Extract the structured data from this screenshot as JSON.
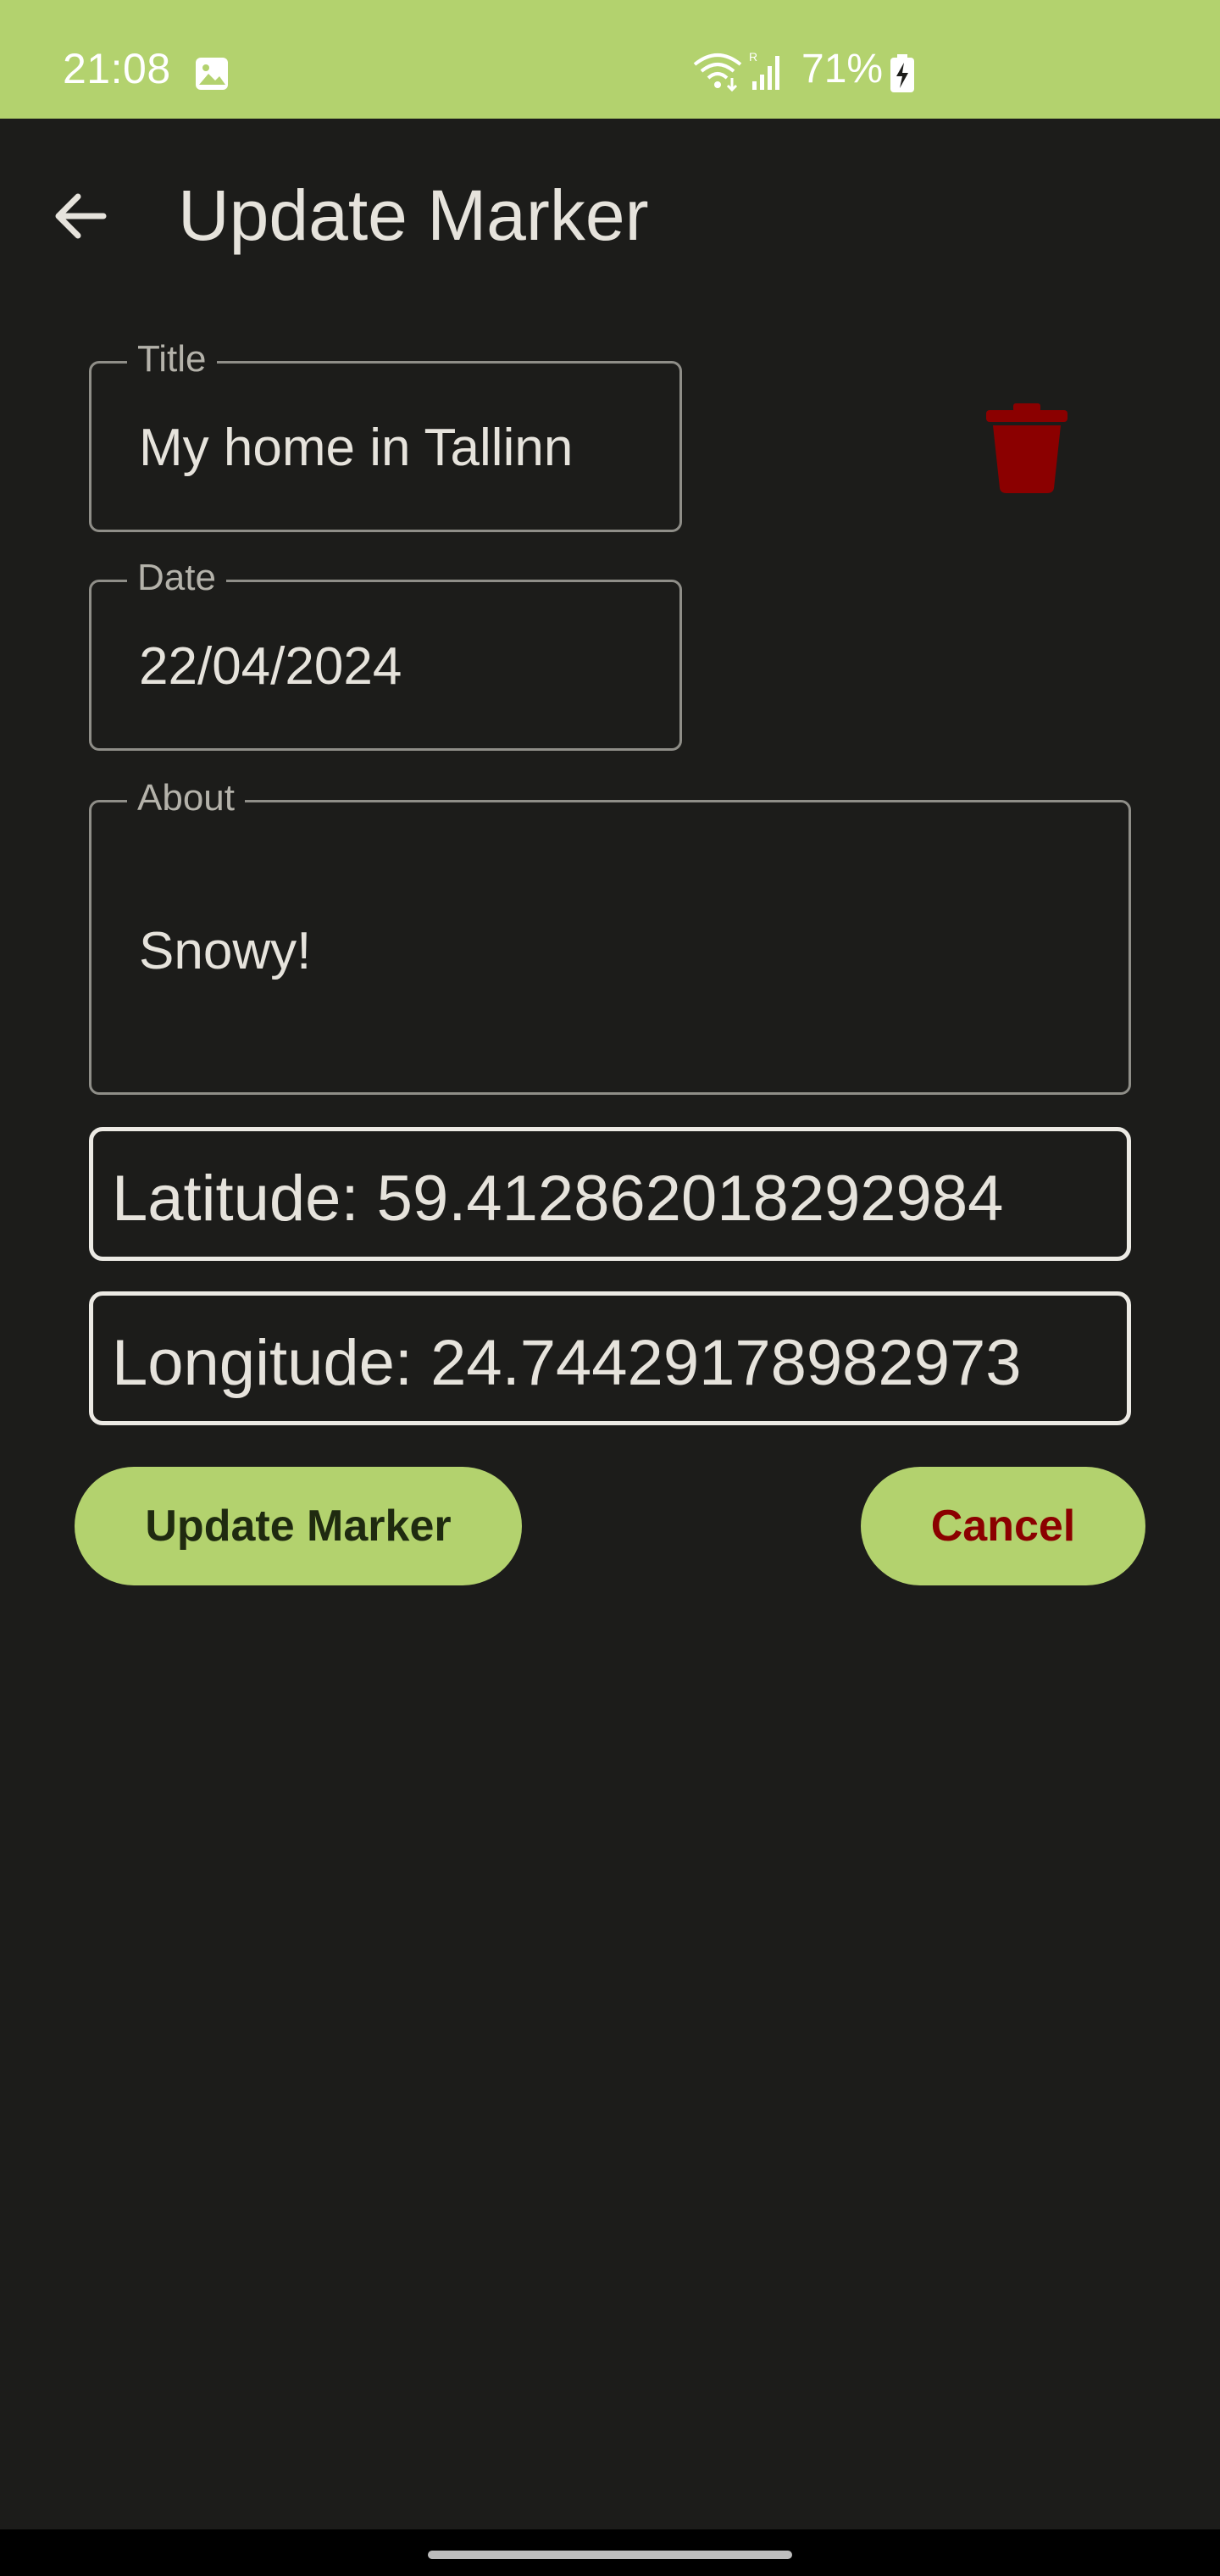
{
  "status_bar": {
    "time": "21:08",
    "battery": "71%",
    "icons": [
      "image-icon",
      "wifi-icon",
      "signal-roaming-icon",
      "battery-charging-icon"
    ]
  },
  "app_bar": {
    "title": "Update Marker",
    "back_icon": "arrow-back-icon"
  },
  "form": {
    "title": {
      "label": "Title",
      "value": "My home in Tallinn"
    },
    "date": {
      "label": "Date",
      "value": "22/04/2024"
    },
    "about": {
      "label": "About",
      "value": "Snowy!"
    },
    "latitude_text": "Latitude: 59.412862018292984",
    "longitude_text": "Longitude: 24.74429178982973",
    "delete_icon": "trash-icon"
  },
  "actions": {
    "update_label": "Update Marker",
    "cancel_label": "Cancel"
  },
  "colors": {
    "accent": "#b3d26e",
    "background": "#1c1c1a",
    "delete": "#8b0000",
    "cancel_text": "#8b0000"
  }
}
